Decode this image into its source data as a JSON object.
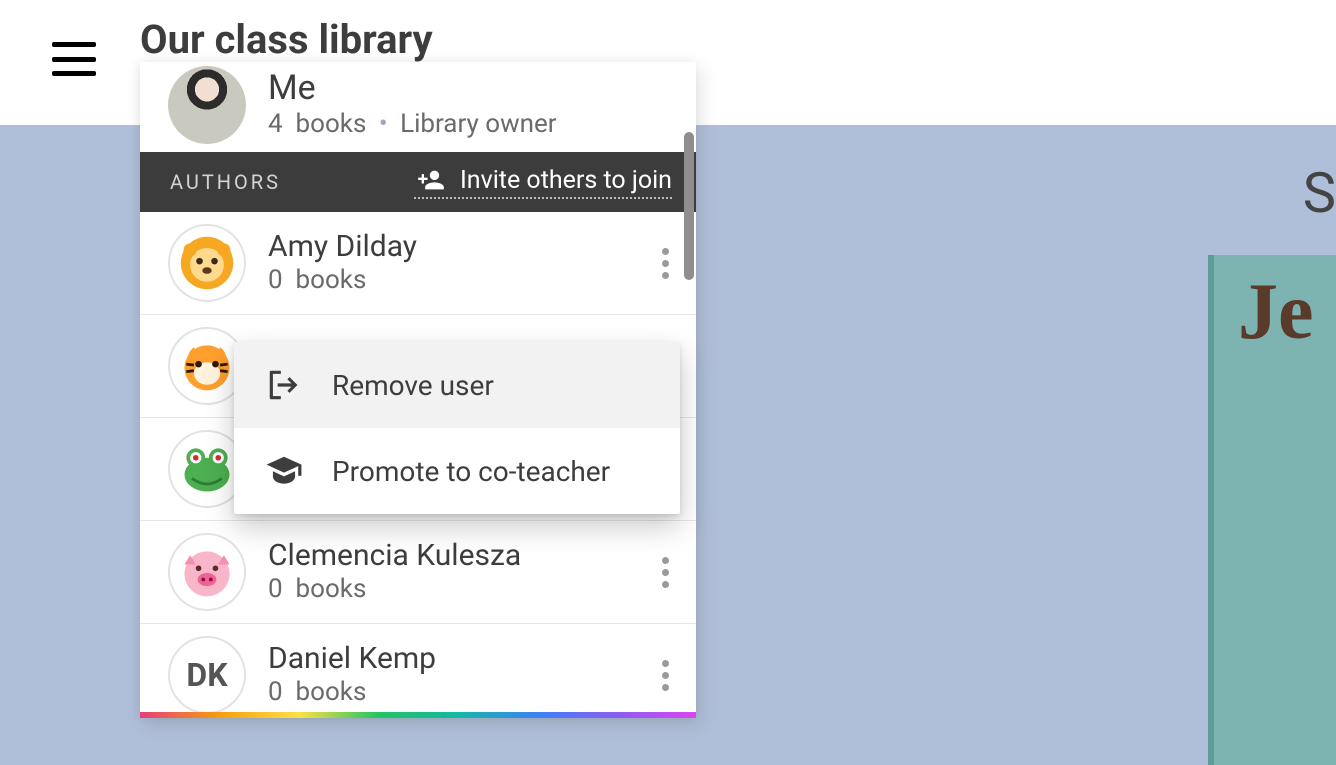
{
  "page_title": "Our class library",
  "side_letter": "S",
  "book_visible_text": "Je",
  "me": {
    "name": "Me",
    "books_count": "4",
    "books_word": "books",
    "role": "Library owner"
  },
  "section": {
    "label": "AUTHORS",
    "invite_label": "Invite others to join"
  },
  "authors": [
    {
      "name": "Amy Dilday",
      "books_count": "0",
      "books_word": "books",
      "avatar": "lion"
    },
    {
      "name": "",
      "books_count": "",
      "books_word": "",
      "avatar": "tiger"
    },
    {
      "name": "",
      "books_count": "",
      "books_word": "",
      "avatar": "frog"
    },
    {
      "name": "Clemencia Kulesza",
      "books_count": "0",
      "books_word": "books",
      "avatar": "pig"
    },
    {
      "name": "Daniel Kemp",
      "books_count": "0",
      "books_word": "books",
      "avatar": "initials",
      "initials": "DK"
    }
  ],
  "menu": {
    "remove": "Remove user",
    "promote": "Promote to co-teacher"
  }
}
